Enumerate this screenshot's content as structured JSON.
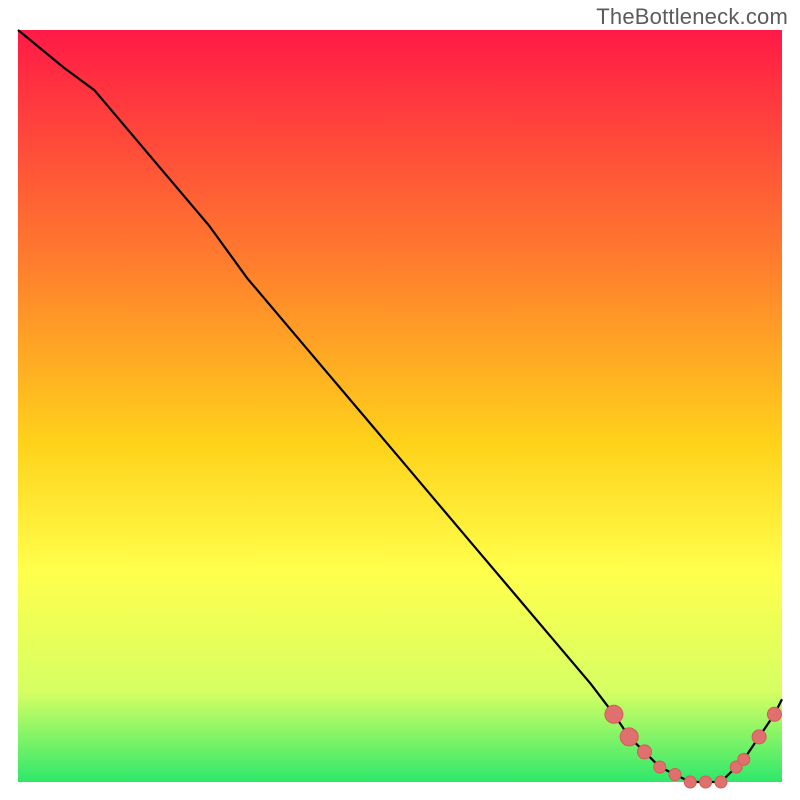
{
  "watermark": "TheBottleneck.com",
  "colors": {
    "gradient_top": "#ff1a46",
    "gradient_mid1": "#ff7a2e",
    "gradient_mid2": "#ffd21a",
    "gradient_mid3": "#ffff4c",
    "gradient_mid4": "#d6ff63",
    "gradient_bot": "#2ee86b",
    "curve": "#000000",
    "marker_fill": "#e0706e",
    "marker_stroke": "#d65a58",
    "frame": "#ffffff"
  },
  "chart_data": {
    "type": "line",
    "title": "",
    "xlabel": "",
    "ylabel": "",
    "xlim": [
      0,
      100
    ],
    "ylim": [
      0,
      100
    ],
    "grid": false,
    "legend": false,
    "x": [
      0,
      6,
      10,
      15,
      20,
      25,
      30,
      35,
      40,
      45,
      50,
      55,
      60,
      65,
      70,
      75,
      78,
      80,
      82,
      84,
      86,
      88,
      90,
      91,
      92,
      93,
      94,
      95,
      97,
      99,
      100
    ],
    "values": [
      100,
      95,
      92,
      86,
      80,
      74,
      67,
      61,
      55,
      49,
      43,
      37,
      31,
      25,
      19,
      13,
      9,
      6,
      4,
      2,
      1,
      0,
      0,
      0,
      0,
      1,
      2,
      3,
      6,
      9,
      11
    ],
    "markers": {
      "x": [
        78,
        80,
        82,
        84,
        86,
        88,
        90,
        92,
        94,
        95,
        97,
        99
      ],
      "values": [
        9,
        6,
        4,
        2,
        1,
        0,
        0,
        0,
        2,
        3,
        6,
        9
      ],
      "size": [
        9,
        9,
        7,
        6,
        6,
        6,
        6,
        6,
        6,
        6,
        7,
        7
      ]
    }
  }
}
